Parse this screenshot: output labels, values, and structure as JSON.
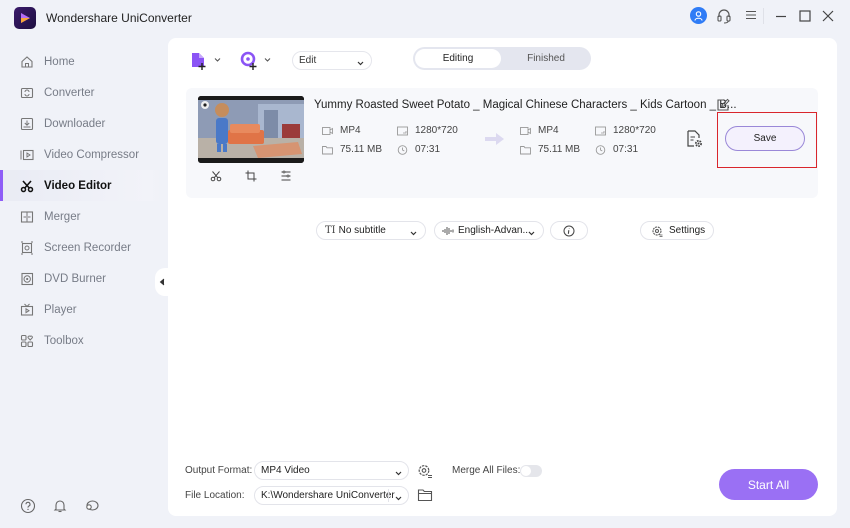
{
  "app": {
    "title": "Wondershare UniConverter"
  },
  "window_controls": {
    "account_icon": "user-icon",
    "support_icon": "headset-icon",
    "menu_icon": "hamburger-menu-icon",
    "minimize_icon": "minimize-icon",
    "maximize_icon": "maximize-icon",
    "close_icon": "close-icon"
  },
  "sidebar": {
    "items": [
      {
        "label": "Home",
        "icon": "home-icon",
        "active": false
      },
      {
        "label": "Converter",
        "icon": "converter-icon",
        "active": false
      },
      {
        "label": "Downloader",
        "icon": "downloader-icon",
        "active": false
      },
      {
        "label": "Video Compressor",
        "icon": "compressor-icon",
        "active": false
      },
      {
        "label": "Video Editor",
        "icon": "scissors-icon",
        "active": true
      },
      {
        "label": "Merger",
        "icon": "merger-icon",
        "active": false
      },
      {
        "label": "Screen Recorder",
        "icon": "screen-recorder-icon",
        "active": false
      },
      {
        "label": "DVD Burner",
        "icon": "dvd-icon",
        "active": false
      },
      {
        "label": "Player",
        "icon": "player-icon",
        "active": false
      },
      {
        "label": "Toolbox",
        "icon": "toolbox-icon",
        "active": false
      }
    ],
    "bottom_icons": [
      "help-icon",
      "bell-icon",
      "feedback-icon"
    ],
    "accent_color": "#8e5cf7"
  },
  "toolbar": {
    "edit_select": "Edit",
    "tabs": [
      {
        "label": "Editing",
        "active": true
      },
      {
        "label": "Finished",
        "active": false
      }
    ]
  },
  "video": {
    "title": "Yummy Roasted Sweet Potato _ Magical Chinese Characters _ Kids Cartoon _ B...",
    "source": {
      "format": "MP4",
      "resolution": "1280*720",
      "size": "75.11 MB",
      "duration": "07:31"
    },
    "target": {
      "format": "MP4",
      "resolution": "1280*720",
      "size": "75.11 MB",
      "duration": "07:31"
    },
    "subtitle": "No subtitle",
    "audio": "English-Advan...",
    "settings_label": "Settings",
    "save_label": "Save"
  },
  "footer": {
    "output_format_label": "Output Format:",
    "output_format_value": "MP4 Video",
    "merge_label": "Merge All Files:",
    "merge_enabled": false,
    "file_location_label": "File Location:",
    "file_location_value": "K:\\Wondershare UniConverter",
    "start_all_label": "Start All",
    "start_color": "#9a70f4"
  },
  "highlight_color": "#d9262c"
}
